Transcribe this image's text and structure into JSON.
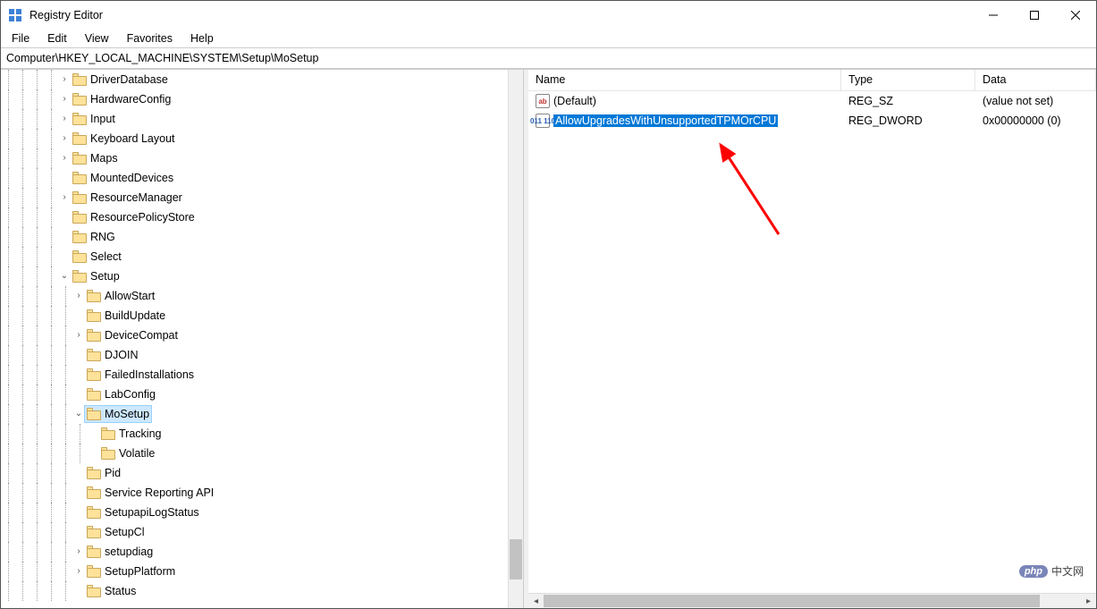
{
  "window": {
    "title": "Registry Editor"
  },
  "menubar": {
    "items": [
      "File",
      "Edit",
      "View",
      "Favorites",
      "Help"
    ]
  },
  "addressbar": {
    "path": "Computer\\HKEY_LOCAL_MACHINE\\SYSTEM\\Setup\\MoSetup"
  },
  "tree": {
    "items": [
      {
        "depth": 4,
        "label": "DriverDatabase",
        "chevron": "right",
        "conn": true
      },
      {
        "depth": 4,
        "label": "HardwareConfig",
        "chevron": "right",
        "conn": true
      },
      {
        "depth": 4,
        "label": "Input",
        "chevron": "right",
        "conn": true
      },
      {
        "depth": 4,
        "label": "Keyboard Layout",
        "chevron": "right",
        "conn": true
      },
      {
        "depth": 4,
        "label": "Maps",
        "chevron": "right",
        "conn": true
      },
      {
        "depth": 4,
        "label": "MountedDevices",
        "chevron": "",
        "conn": true
      },
      {
        "depth": 4,
        "label": "ResourceManager",
        "chevron": "right",
        "conn": true
      },
      {
        "depth": 4,
        "label": "ResourcePolicyStore",
        "chevron": "",
        "conn": true
      },
      {
        "depth": 4,
        "label": "RNG",
        "chevron": "",
        "conn": true
      },
      {
        "depth": 4,
        "label": "Select",
        "chevron": "",
        "conn": true
      },
      {
        "depth": 4,
        "label": "Setup",
        "chevron": "down",
        "conn": true
      },
      {
        "depth": 5,
        "label": "AllowStart",
        "chevron": "right",
        "conn": true
      },
      {
        "depth": 5,
        "label": "BuildUpdate",
        "chevron": "",
        "conn": true
      },
      {
        "depth": 5,
        "label": "DeviceCompat",
        "chevron": "right",
        "conn": true
      },
      {
        "depth": 5,
        "label": "DJOIN",
        "chevron": "",
        "conn": true
      },
      {
        "depth": 5,
        "label": "FailedInstallations",
        "chevron": "",
        "conn": true
      },
      {
        "depth": 5,
        "label": "LabConfig",
        "chevron": "",
        "conn": true
      },
      {
        "depth": 5,
        "label": "MoSetup",
        "chevron": "down",
        "conn": true,
        "selected": true
      },
      {
        "depth": 6,
        "label": "Tracking",
        "chevron": "",
        "conn": true
      },
      {
        "depth": 6,
        "label": "Volatile",
        "chevron": "",
        "conn": true
      },
      {
        "depth": 5,
        "label": "Pid",
        "chevron": "",
        "conn": true
      },
      {
        "depth": 5,
        "label": "Service Reporting API",
        "chevron": "",
        "conn": true
      },
      {
        "depth": 5,
        "label": "SetupapiLogStatus",
        "chevron": "",
        "conn": true
      },
      {
        "depth": 5,
        "label": "SetupCl",
        "chevron": "",
        "conn": true
      },
      {
        "depth": 5,
        "label": "setupdiag",
        "chevron": "right",
        "conn": true
      },
      {
        "depth": 5,
        "label": "SetupPlatform",
        "chevron": "right",
        "conn": true
      },
      {
        "depth": 5,
        "label": "Status",
        "chevron": "",
        "conn": true
      }
    ]
  },
  "list": {
    "columns": {
      "name": "Name",
      "type": "Type",
      "data": "Data"
    },
    "rows": [
      {
        "icon": "str",
        "name": "(Default)",
        "type": "REG_SZ",
        "data": "(value not set)",
        "selected": false
      },
      {
        "icon": "bin",
        "name": "AllowUpgradesWithUnsupportedTPMOrCPU",
        "type": "REG_DWORD",
        "data": "0x00000000 (0)",
        "selected": true
      }
    ]
  },
  "watermark": {
    "badge": "php",
    "text": "中文网"
  }
}
